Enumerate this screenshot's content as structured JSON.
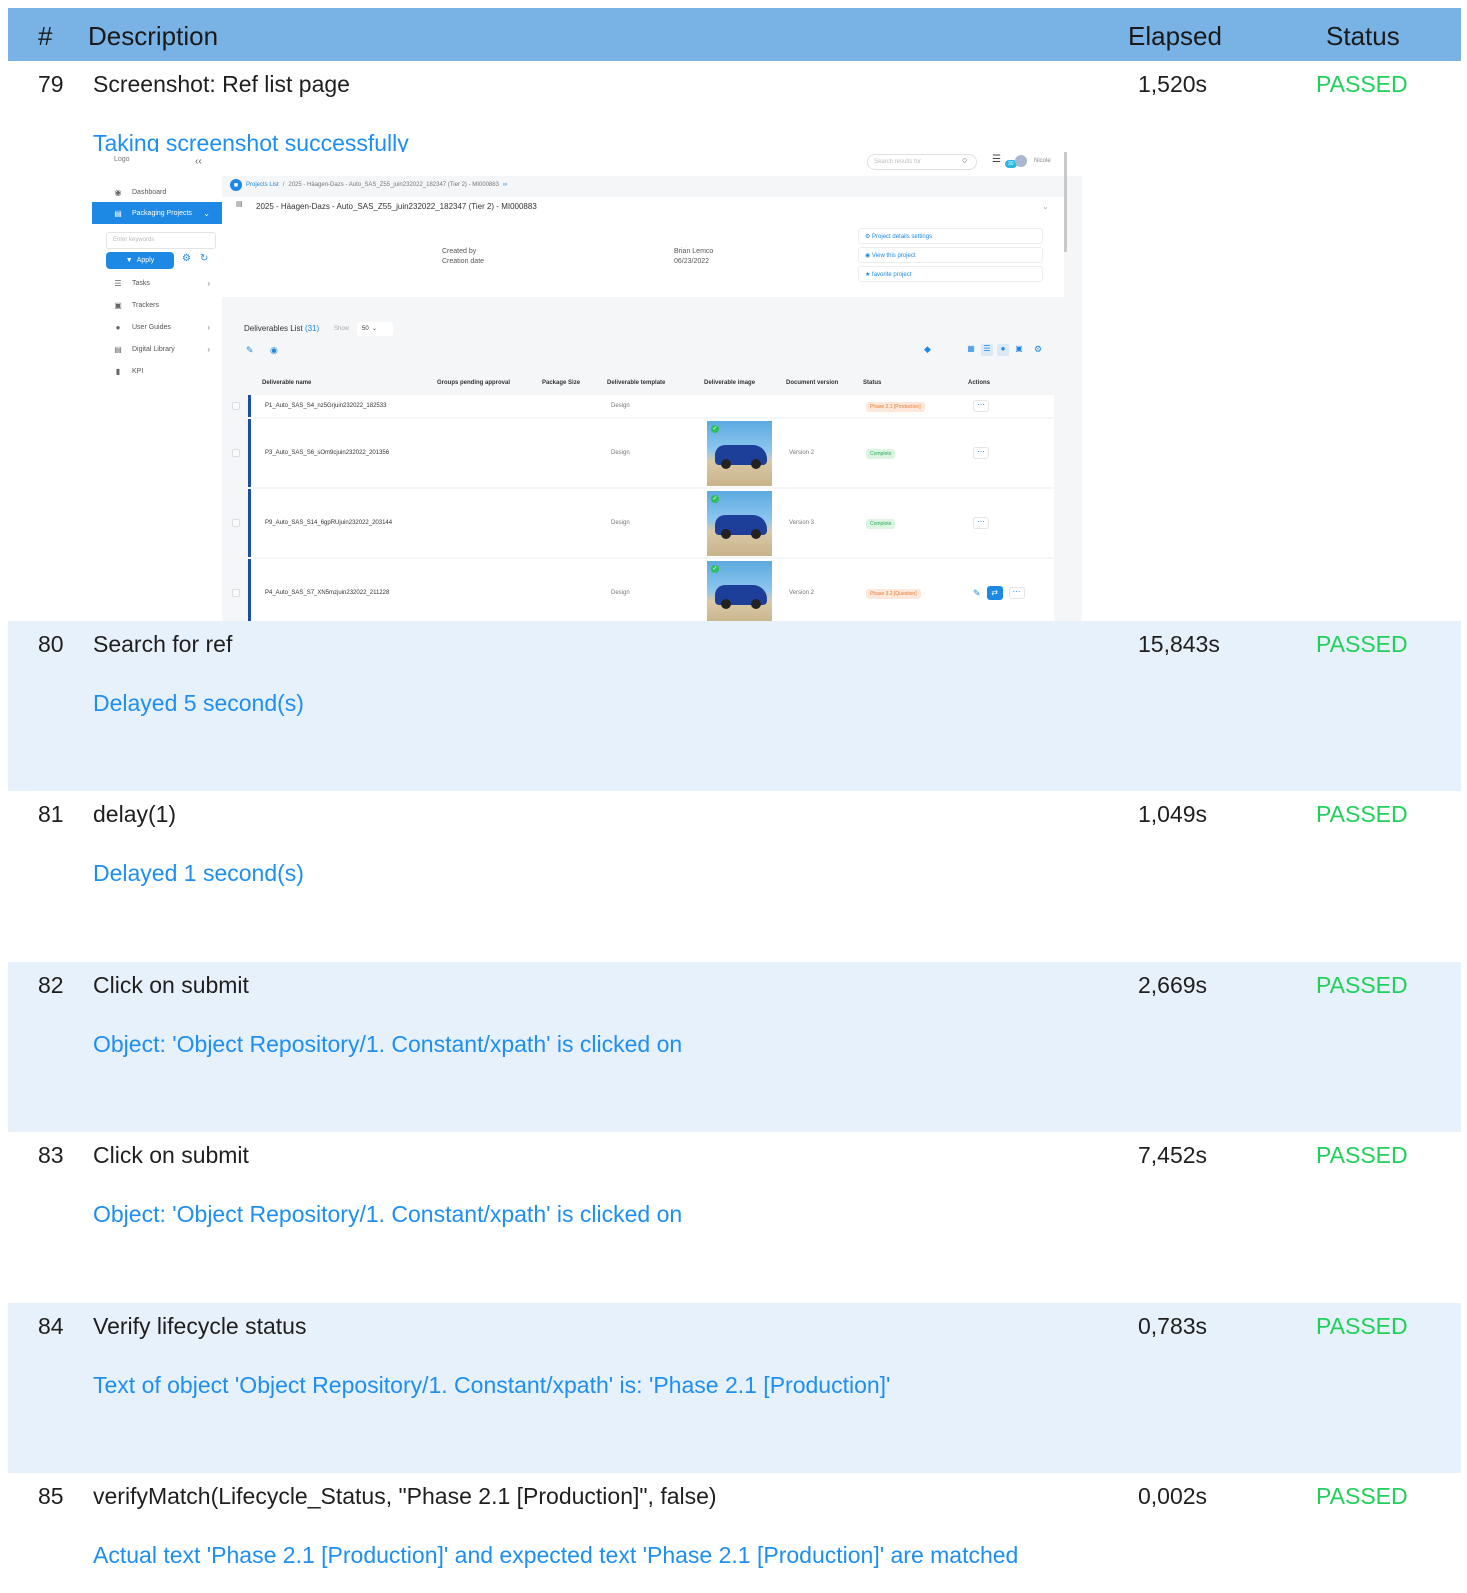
{
  "header": {
    "num": "#",
    "description": "Description",
    "elapsed": "Elapsed",
    "status": "Status"
  },
  "steps": [
    {
      "num": "79",
      "title": "Screenshot: Ref list page",
      "elapsed": "1,520s",
      "status": "PASSED",
      "message": "Taking screenshot successfully"
    },
    {
      "num": "80",
      "title": "Search for ref",
      "elapsed": "15,843s",
      "status": "PASSED",
      "message": "Delayed 5 second(s)"
    },
    {
      "num": "81",
      "title": "delay(1)",
      "elapsed": "1,049s",
      "status": "PASSED",
      "message": "Delayed 1 second(s)"
    },
    {
      "num": "82",
      "title": "Click on submit",
      "elapsed": "2,669s",
      "status": "PASSED",
      "message": "Object: 'Object Repository/1. Constant/xpath' is clicked on"
    },
    {
      "num": "83",
      "title": "Click on submit",
      "elapsed": "7,452s",
      "status": "PASSED",
      "message": "Object: 'Object Repository/1. Constant/xpath' is clicked on"
    },
    {
      "num": "84",
      "title": "Verify lifecycle status",
      "elapsed": "0,783s",
      "status": "PASSED",
      "message": "Text of object 'Object Repository/1. Constant/xpath' is: 'Phase 2.1 [Production]'"
    },
    {
      "num": "85",
      "title": "verifyMatch(Lifecycle_Status, \"Phase 2.1 [Production]\", false)",
      "elapsed": "0,002s",
      "status": "PASSED",
      "message": "Actual text 'Phase 2.1 [Production]' and expected text 'Phase 2.1 [Production]' are matched"
    }
  ],
  "shot": {
    "logo": "Logo",
    "sidebar": {
      "dashboard": "Dashboard",
      "packaging": "Packaging Projects",
      "keywords_placeholder": "Enter keywords",
      "apply": "Apply",
      "tasks": "Tasks",
      "trackers": "Trackers",
      "guides": "User Guides",
      "library": "Digital Library",
      "kpi": "KPI"
    },
    "topbar": {
      "search_placeholder": "Search results for",
      "badge": "30",
      "user": "Nicole"
    },
    "breadcrumb": {
      "root": "Projects List",
      "sep": "/",
      "current": "2025 - Häagen-Dazs - Auto_SAS_Z55_juin232022_182347 (Tier 2) - MI000883"
    },
    "project": {
      "title": "2025 - Häagen-Dazs - Auto_SAS_Z55_juin232022_182347 (Tier 2) - MI000883",
      "created_by_label": "Created by",
      "creation_date_label": "Creation date",
      "created_by": "Brian Lemco",
      "creation_date": "06/23/2022",
      "links": [
        "Project details settings",
        "View this project",
        "favorite project"
      ]
    },
    "deliverables": {
      "title": "Deliverables List",
      "count": "(31)",
      "show_label": "Show",
      "show_value": "50",
      "columns": [
        "Deliverable name",
        "Groups pending approval",
        "Package Size",
        "Deliverable template",
        "Deliverable image",
        "Document version",
        "Status",
        "Actions"
      ],
      "rows": [
        {
          "name": "P1_Auto_SAS_S4_nz5Grjuin232022_182533",
          "template": "Design",
          "version": "",
          "status": "Phase 2.1 [Production]"
        },
        {
          "name": "P3_Auto_SAS_S6_sOm9cjuin232022_201356",
          "template": "Design",
          "version": "Version 2",
          "status": "Complete"
        },
        {
          "name": "P9_Auto_SAS_S14_6gpRUjuin232022_203144",
          "template": "Design",
          "version": "Version 3",
          "status": "Complete"
        },
        {
          "name": "P4_Auto_SAS_S7_XN5mzjuin232022_211228",
          "template": "Design",
          "version": "Version 2",
          "status": "Phase 3.2 [Question]"
        }
      ]
    }
  }
}
